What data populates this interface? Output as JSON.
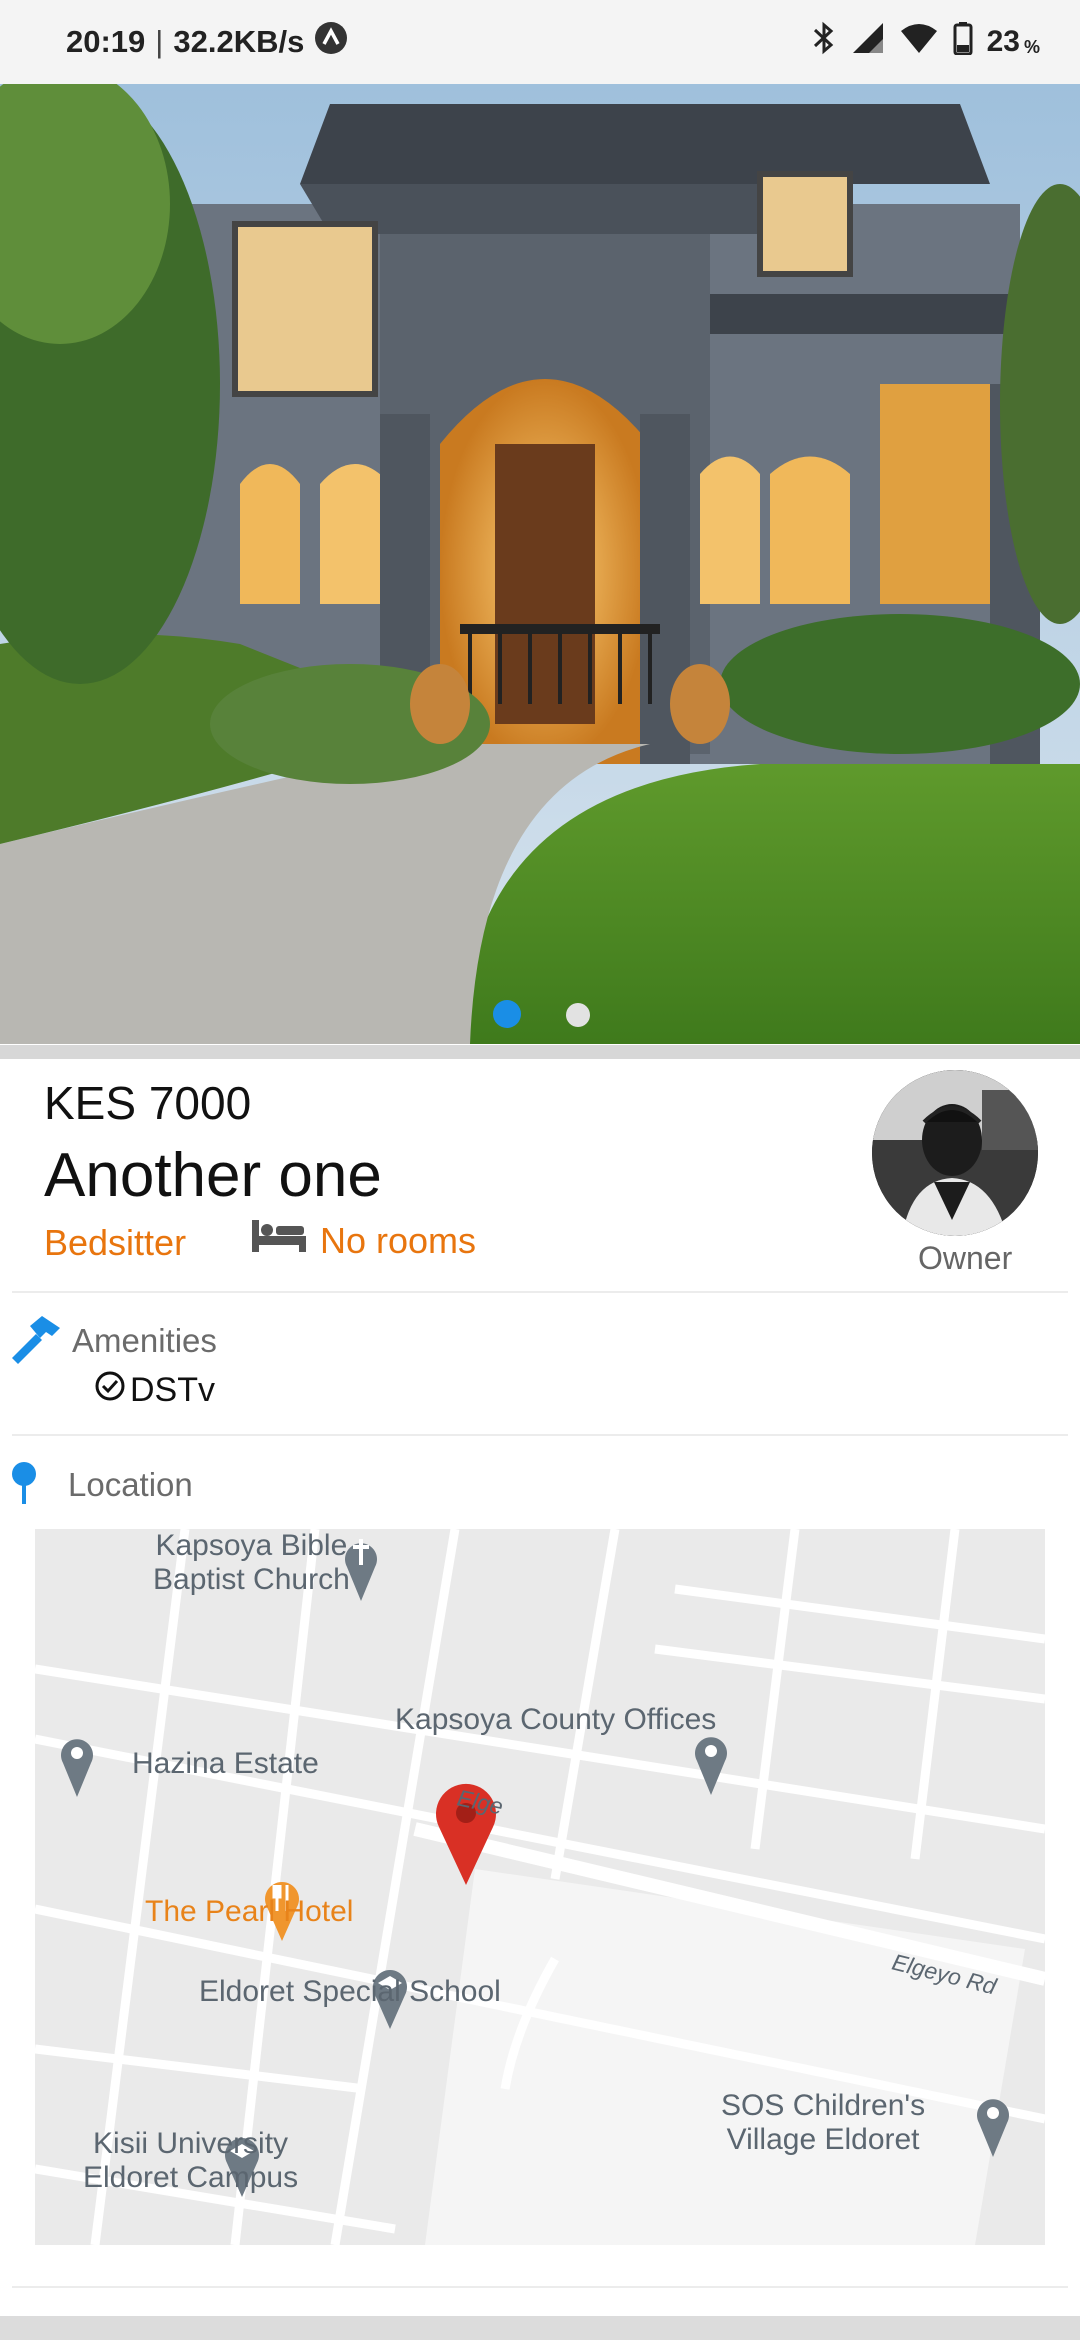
{
  "status_bar": {
    "time": "20:19",
    "speed": "32.2KB/s",
    "battery": "23",
    "battery_unit": "%",
    "icons": [
      "vpn-icon",
      "bluetooth-icon",
      "signal-icon",
      "wifi-icon",
      "battery-icon"
    ]
  },
  "gallery": {
    "image_count": 2,
    "current_index": 0
  },
  "listing": {
    "price": "KES 7000",
    "title": "Another one",
    "category": "Bedsitter",
    "rooms": "No rooms",
    "owner_label": "Owner"
  },
  "amenities": {
    "heading": "Amenities",
    "items": [
      "DSTv"
    ]
  },
  "location": {
    "heading": "Location",
    "map_labels": {
      "church_line1": "Kapsoya Bible",
      "church_line2": "Baptist Church",
      "county_offices": "Kapsoya County Offices",
      "hazina": "Hazina Estate",
      "pearl_hotel": "The Pearl Hotel",
      "special_school": "Eldoret Special School",
      "sos_line1": "SOS Children's",
      "sos_line2": "Village Eldoret",
      "kisii_line1": "Kisii University",
      "kisii_line2": "Eldoret Campus",
      "road_elgeyo": "Elgeyo Rd",
      "road_elge": "Elge"
    }
  },
  "colors": {
    "accent_orange": "#e8750e",
    "accent_blue": "#1a8ee6",
    "map_pin_red": "#d93025"
  }
}
